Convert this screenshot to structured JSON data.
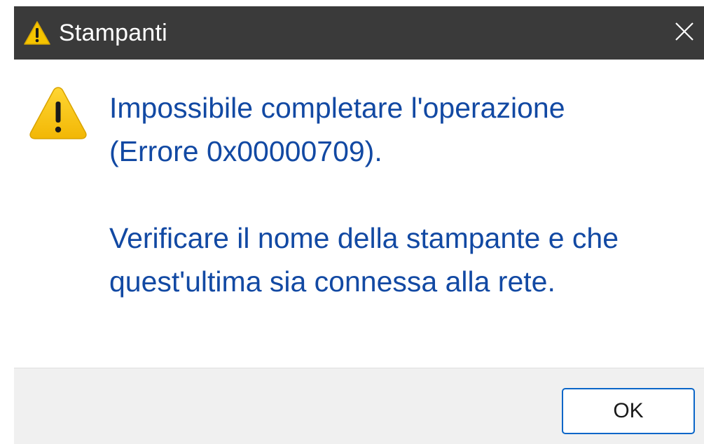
{
  "window": {
    "title": "Stampanti",
    "title_icon": "warning-icon",
    "close_icon": "close-icon"
  },
  "message": {
    "icon": "warning-icon",
    "line1": "Impossibile completare l'operazione",
    "line2": "(Errore 0x00000709).",
    "line3": "Verificare il nome della stampante e che",
    "line4": "quest'ultima sia connessa alla rete."
  },
  "buttons": {
    "ok_label": "OK"
  },
  "colors": {
    "titlebar": "#3a3a3a",
    "message_text": "#1249a3",
    "warning_yellow": "#f5c400",
    "button_border": "#0b66c8",
    "footer": "#f0f0f0"
  }
}
